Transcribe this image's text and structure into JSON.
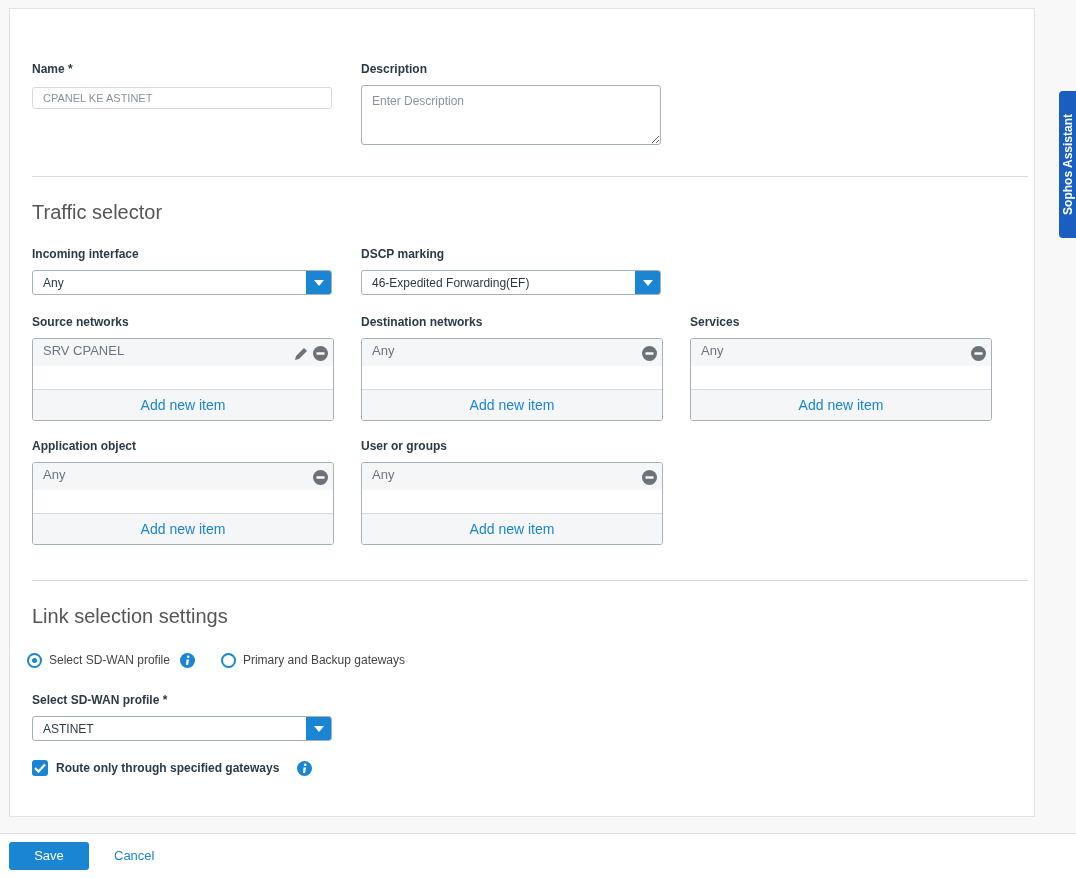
{
  "general": {
    "name": {
      "label": "Name *",
      "value": "CPANEL KE ASTINET",
      "disabled": true
    },
    "description": {
      "label": "Description",
      "placeholder": "Enter Description"
    }
  },
  "traffic_selector": {
    "title": "Traffic selector",
    "dropdowns": [
      {
        "label": "Incoming interface",
        "value": "Any"
      },
      {
        "label": "DSCP marking",
        "value": "46-Expedited Forwarding(EF)"
      }
    ],
    "lists": [
      {
        "label": "Source networks",
        "items": [
          {
            "text": "SRV CPANEL",
            "editable": true
          }
        ],
        "add_label": "Add new item"
      },
      {
        "label": "Destination networks",
        "items": [
          {
            "text": "Any",
            "editable": false
          }
        ],
        "add_label": "Add new item"
      },
      {
        "label": "Services",
        "items": [
          {
            "text": "Any",
            "editable": false
          }
        ],
        "add_label": "Add new item"
      },
      {
        "label": "Application object",
        "items": [
          {
            "text": "Any",
            "editable": false
          }
        ],
        "add_label": "Add new item"
      },
      {
        "label": "User or groups",
        "items": [
          {
            "text": "Any",
            "editable": false
          }
        ],
        "add_label": "Add new item"
      }
    ]
  },
  "link_selection": {
    "title": "Link selection settings",
    "options": [
      {
        "label": "Select SD-WAN profile",
        "selected": true,
        "info": true
      },
      {
        "label": "Primary and Backup gateways",
        "selected": false,
        "info": false
      }
    ],
    "profile": {
      "label": "Select SD-WAN profile *",
      "value": "ASTINET"
    },
    "route_only": {
      "label": "Route only through specified gateways",
      "checked": true
    }
  },
  "footer": {
    "save": "Save",
    "cancel": "Cancel"
  },
  "assistant_tab": "Sophos Assistant"
}
